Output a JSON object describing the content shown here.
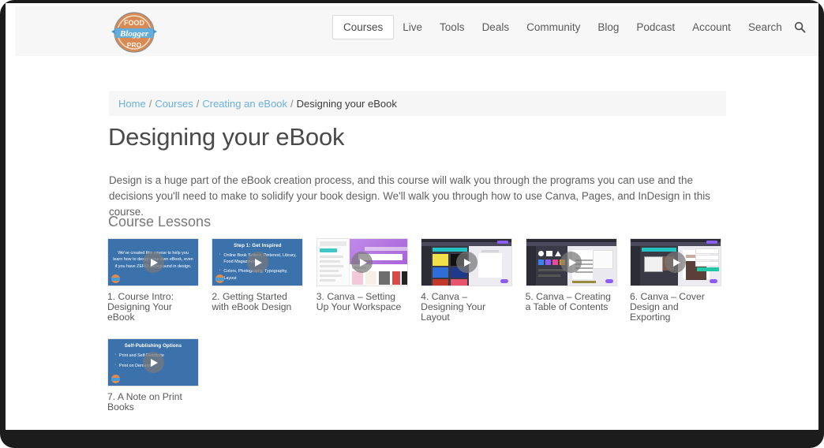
{
  "site": {
    "logo_alt": "Food Blogger Pro",
    "logo_line1": "FOOD",
    "logo_line2": "Blogger",
    "logo_line3": "PRO"
  },
  "nav": {
    "items": [
      {
        "label": "Courses",
        "active": true
      },
      {
        "label": "Live",
        "active": false
      },
      {
        "label": "Tools",
        "active": false
      },
      {
        "label": "Deals",
        "active": false
      },
      {
        "label": "Community",
        "active": false
      },
      {
        "label": "Blog",
        "active": false
      },
      {
        "label": "Podcast",
        "active": false
      },
      {
        "label": "Account",
        "active": false
      },
      {
        "label": "Search",
        "active": false
      }
    ],
    "search_icon": "search-icon"
  },
  "breadcrumb": {
    "items": [
      {
        "label": "Home",
        "link": true
      },
      {
        "label": "Courses",
        "link": true
      },
      {
        "label": "Creating an eBook",
        "link": true
      },
      {
        "label": "Designing your eBook",
        "link": false
      }
    ],
    "separator": "/"
  },
  "page": {
    "title": "Designing your eBook",
    "description": "Design is a huge part of the eBook creation process, and this course will walk you through the programs you can use and the decisions you'll need to make to solidify your book design. We'll walk you through how to use Canva, Pages, and InDesign in this course.",
    "section_title": "Course Lessons"
  },
  "lessons": [
    {
      "caption": "1. Course Intro: Designing Your eBook",
      "thumb_type": "slide",
      "slide_title": "",
      "slide_text": "We've created this course to help you learn how to design your own eBook, even if you have ZERO background in design.",
      "bullets": []
    },
    {
      "caption": "2. Getting Started with eBook Design",
      "thumb_type": "slide",
      "slide_title": "Step 1: Get Inspired",
      "slide_text": "",
      "bullets": [
        "Online Book Sellers, Pinterest, Library, Food Magazines",
        "Colors, Photography, Typography, Layout"
      ]
    },
    {
      "caption": "3. Canva – Setting Up Your Workspace",
      "thumb_type": "screenshot",
      "accent": "#a855d6"
    },
    {
      "caption": "4. Canva – Designing Your Layout",
      "thumb_type": "screenshot",
      "accent": "#7c3aed"
    },
    {
      "caption": "5. Canva – Creating a Table of Contents",
      "thumb_type": "screenshot",
      "accent": "#8b5cf6"
    },
    {
      "caption": "6. Canva – Cover Design and Exporting",
      "thumb_type": "screenshot",
      "accent": "#7c3aed"
    },
    {
      "caption": "7. A Note on Print Books",
      "thumb_type": "slide",
      "slide_title": "Self-Publishing Options",
      "slide_text": "",
      "bullets": [
        "Print and Self-Distribute",
        "Print on Demand"
      ]
    }
  ],
  "colors": {
    "link": "#6ab0e0",
    "slide_bg": "#3b72ab",
    "header_bg": "#f7f7f7",
    "breadcrumb_bg": "#f6f6f6",
    "logo_orange": "#e08a4c",
    "logo_blue": "#4c9ad4"
  }
}
